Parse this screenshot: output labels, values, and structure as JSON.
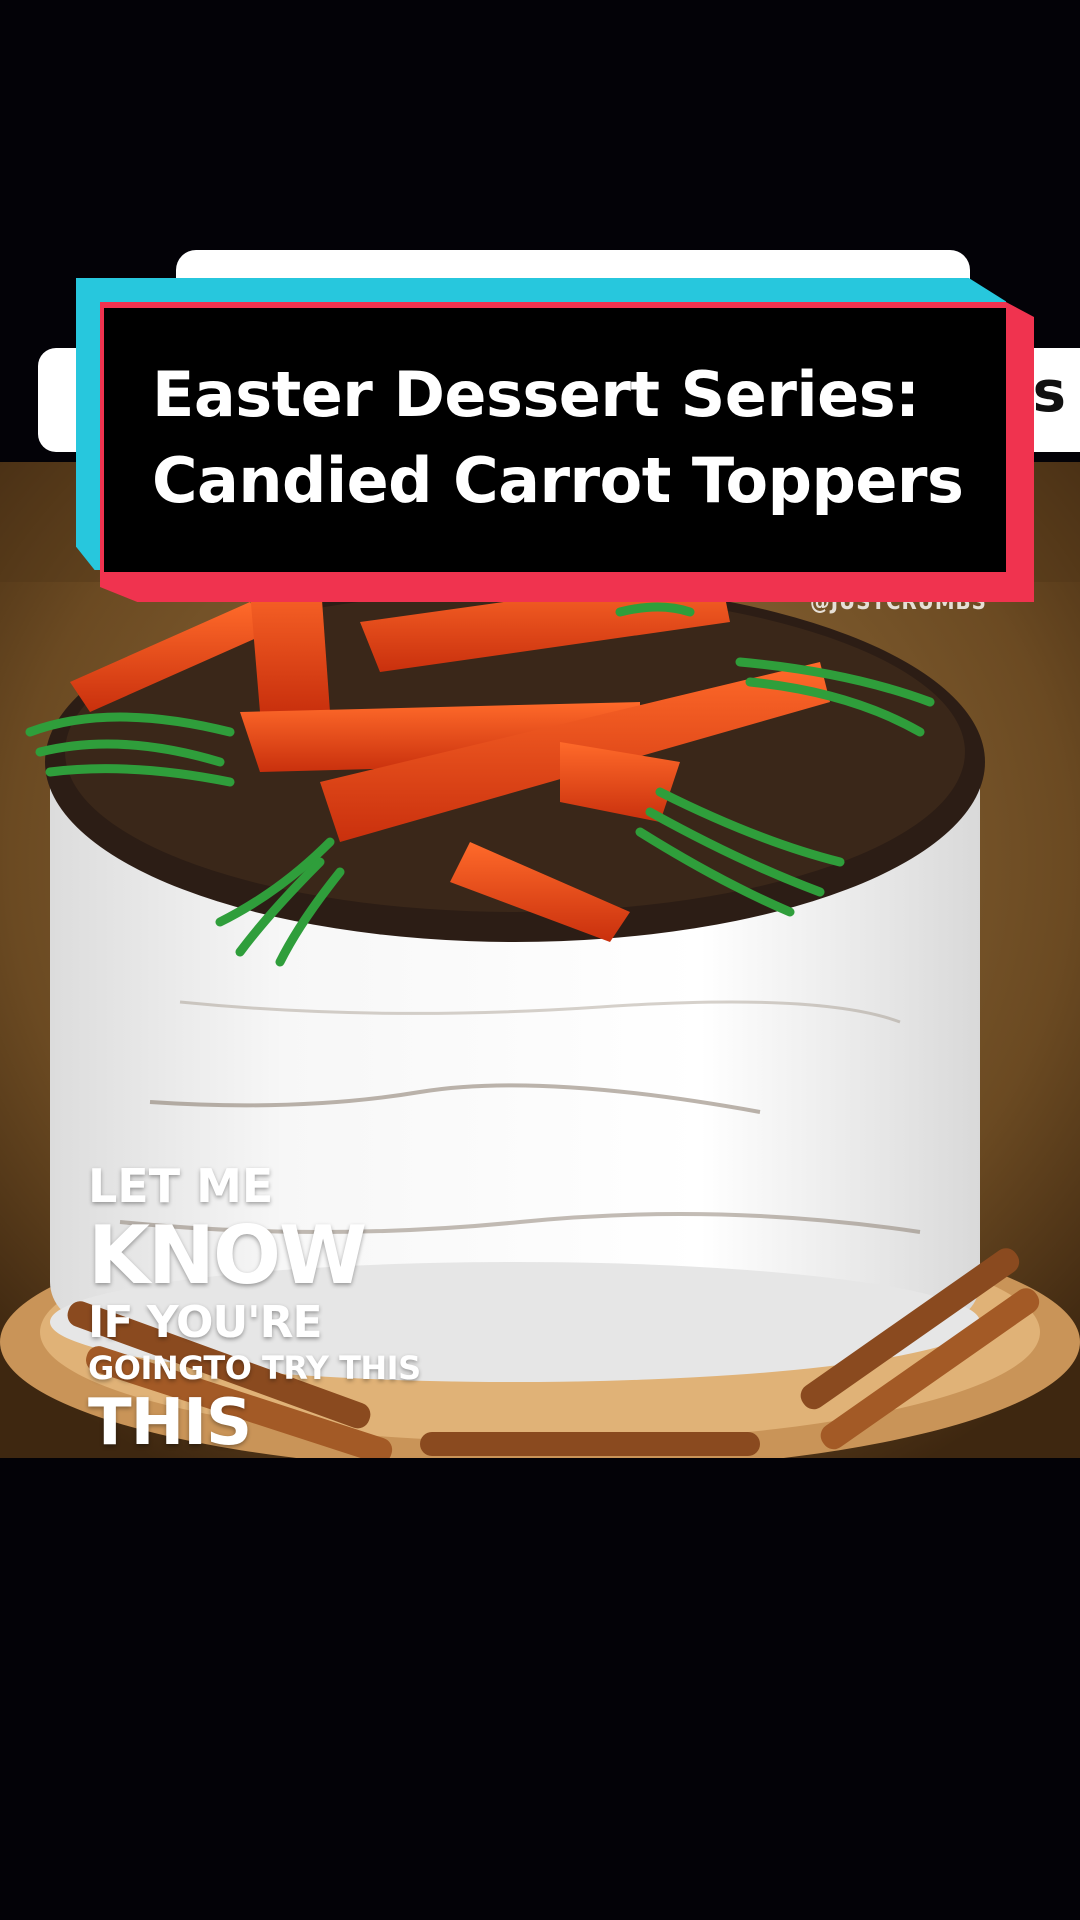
{
  "title_card": {
    "line1": "Easter Dessert Series:",
    "line2": "Candied Carrot Toppers",
    "accent_teal": "#27c7dd",
    "accent_red": "#f0334f"
  },
  "background_partial_text": "s",
  "video": {
    "watermark": "@JUSTCRUMBS",
    "cta": {
      "line1": "LET ME",
      "line2": "KNOW",
      "line3": "IF YOU'RE",
      "line4": "GOINGTO TRY THIS",
      "line5": "THIS"
    }
  }
}
